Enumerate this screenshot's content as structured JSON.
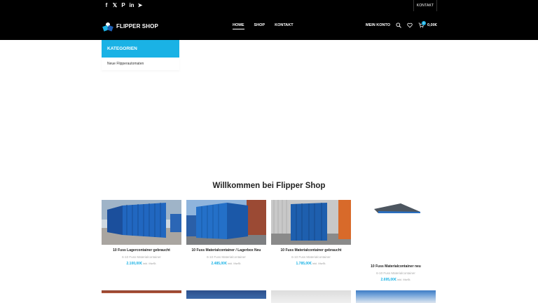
{
  "header": {
    "social_icons": [
      "facebook-icon",
      "x-icon",
      "pinterest-icon",
      "linkedin-icon",
      "telegram-icon"
    ],
    "social_glyphs": [
      "f",
      "𝕏",
      "P",
      "in",
      "➤"
    ],
    "kontakt_top": "KONTAKT",
    "logo_text": "FLIPPER SHOP",
    "nav": [
      "HOME",
      "SHOP",
      "KONTAKT"
    ],
    "account": "MEIN KONTO",
    "cart_count": "0",
    "cart_total": "0,00€"
  },
  "sidebar": {
    "title": "KATEGORIEN",
    "items": [
      "Neue Flipperautomaten"
    ]
  },
  "main": {
    "welcome": "Willkommen bei Flipper Shop",
    "products": [
      {
        "name": "10 Fuss Lagercontainer gebraucht",
        "category": "6-10 Fuss Materialcontainer",
        "price": "2.100,00€",
        "tax": "inkl. MwSt."
      },
      {
        "name": "10 Fuss Materialcontainer / Lagerbox Neu",
        "category": "6-10 Fuss Materialcontainer",
        "price": "2.485,00€",
        "tax": "inkl. MwSt."
      },
      {
        "name": "10 Fuss Materialcontainer gebraucht",
        "category": "6-10 Fuss Materialcontainer",
        "price": "1.785,00€",
        "tax": "inkl. MwSt."
      },
      {
        "name": "10 Fuss Materialcontainer neu",
        "category": "6-10 Fuss Materialcontainer",
        "price": "2.695,00€",
        "tax": "inkl. MwSt."
      }
    ]
  },
  "colors": {
    "accent": "#1ab2e5",
    "header_bg": "#000000",
    "container_blue": "#1e5fb4"
  }
}
